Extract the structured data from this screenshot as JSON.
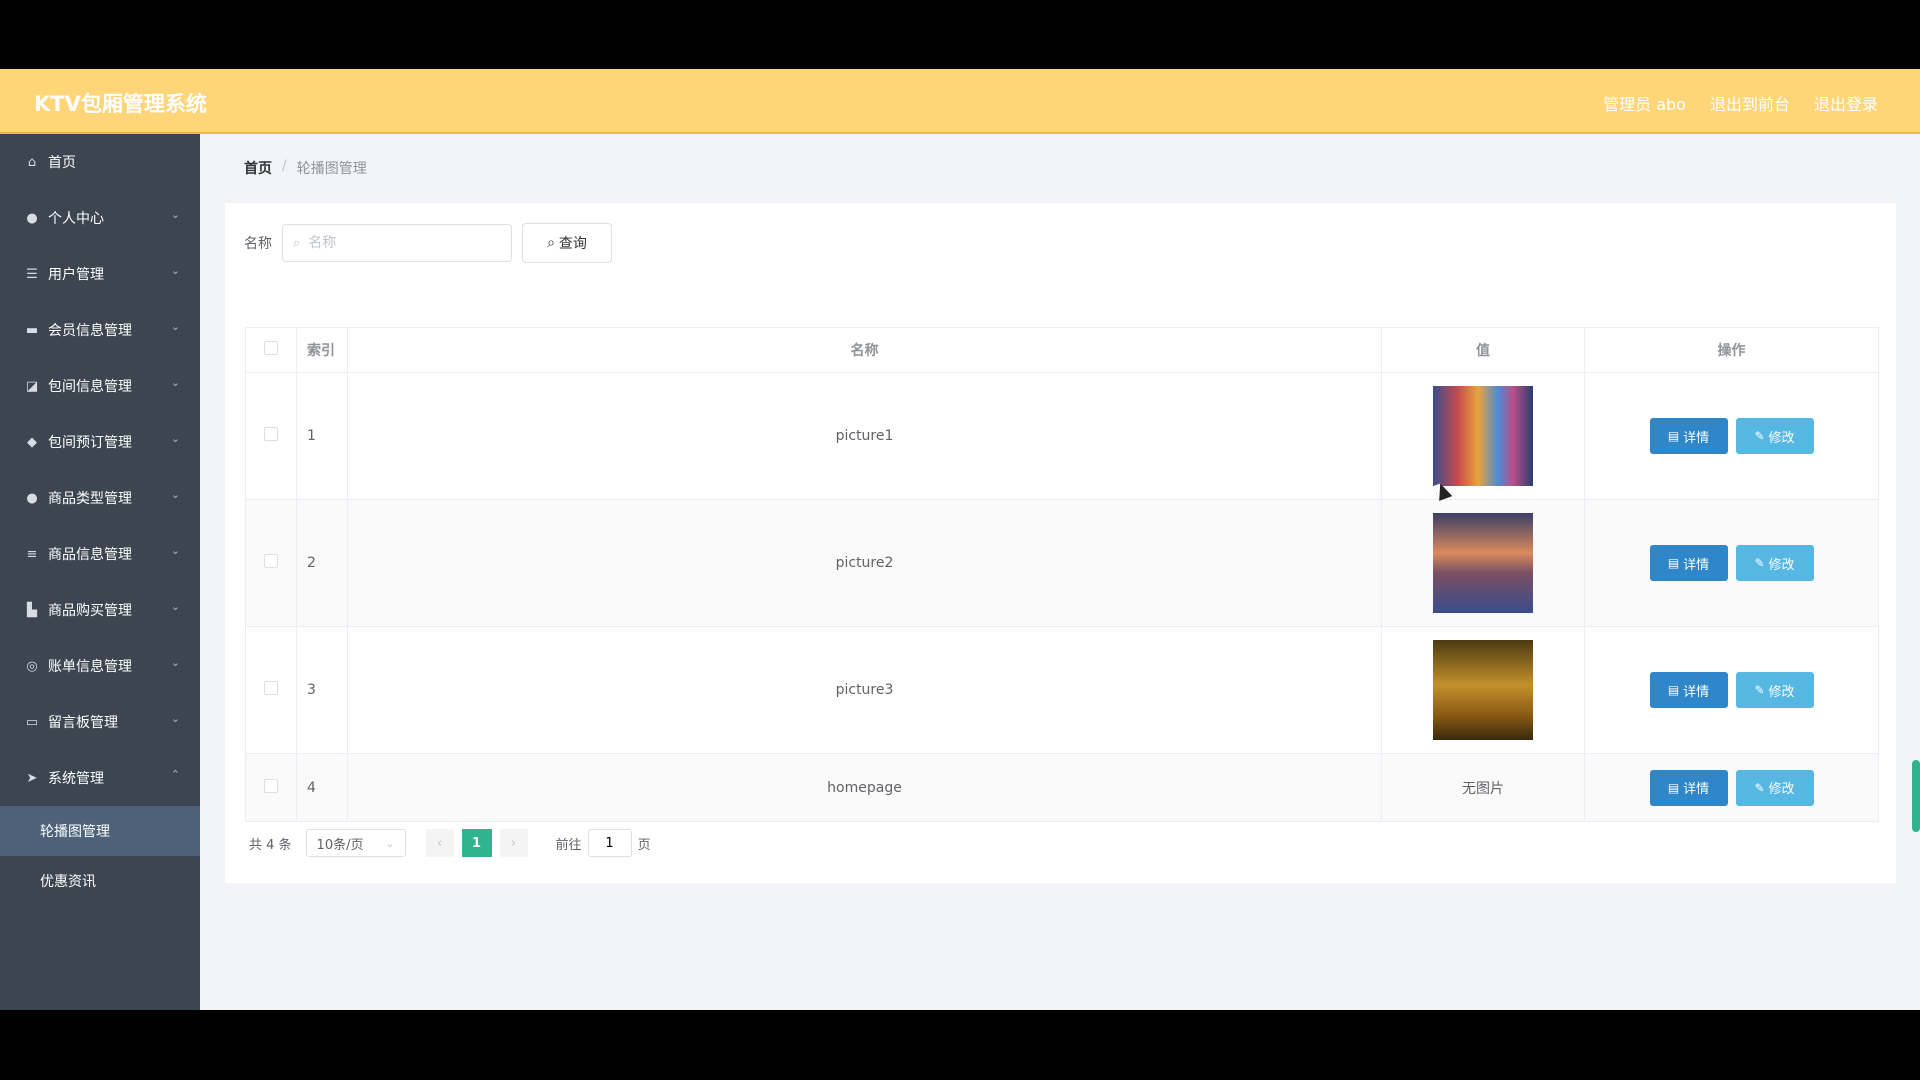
{
  "header": {
    "brand": "KTV包厢管理系统",
    "links": [
      "管理员 abo",
      "退出到前台",
      "退出登录"
    ]
  },
  "sidebar": {
    "items": [
      {
        "label": "首页",
        "icon": "home-icon",
        "glyph": "⌂",
        "arrow": ""
      },
      {
        "label": "个人中心",
        "icon": "user-icon",
        "glyph": "●",
        "arrow": "⌄"
      },
      {
        "label": "用户管理",
        "icon": "menu-icon",
        "glyph": "☰",
        "arrow": "⌄"
      },
      {
        "label": "会员信息管理",
        "icon": "monitor-icon",
        "glyph": "▬",
        "arrow": "⌄"
      },
      {
        "label": "包间信息管理",
        "icon": "chart-icon",
        "glyph": "◪",
        "arrow": "⌄"
      },
      {
        "label": "包间预订管理",
        "icon": "location-icon",
        "glyph": "◆",
        "arrow": "⌄"
      },
      {
        "label": "商品类型管理",
        "icon": "user-icon",
        "glyph": "●",
        "arrow": "⌄"
      },
      {
        "label": "商品信息管理",
        "icon": "sliders-icon",
        "glyph": "≡",
        "arrow": "⌄"
      },
      {
        "label": "商品购买管理",
        "icon": "thumb-icon",
        "glyph": "▙",
        "arrow": "⌄"
      },
      {
        "label": "账单信息管理",
        "icon": "globe-icon",
        "glyph": "◎",
        "arrow": "⌄"
      },
      {
        "label": "留言板管理",
        "icon": "message-icon",
        "glyph": "▭",
        "arrow": "⌄"
      },
      {
        "label": "系统管理",
        "icon": "send-icon",
        "glyph": "➤",
        "arrow": "⌃"
      }
    ],
    "sub_items": [
      "轮播图管理",
      "优惠资讯"
    ]
  },
  "breadcrumb": {
    "home": "首页",
    "sep": "/",
    "current": "轮播图管理"
  },
  "search": {
    "label": "名称",
    "placeholder": "名称",
    "button": "查询"
  },
  "table": {
    "headers": [
      "索引",
      "名称",
      "值",
      "操作"
    ],
    "rows": [
      {
        "index": "1",
        "name": "picture1",
        "value": "",
        "image": "thumb1"
      },
      {
        "index": "2",
        "name": "picture2",
        "value": "",
        "image": "thumb2"
      },
      {
        "index": "3",
        "name": "picture3",
        "value": "",
        "image": "thumb3"
      },
      {
        "index": "4",
        "name": "homepage",
        "value": "无图片",
        "image": ""
      }
    ],
    "actions": {
      "detail": "详情",
      "edit": "修改"
    }
  },
  "pagination": {
    "total": "共 4 条",
    "page_size": "10条/页",
    "current_page": "1",
    "goto_label": "前往",
    "goto_value": "1",
    "page_unit": "页"
  },
  "colors": {
    "header": "#ffd57a",
    "sidebar": "#3c4550",
    "primary": "#2f86c9",
    "secondary": "#56b8e2",
    "active_page": "#2fb48d"
  }
}
